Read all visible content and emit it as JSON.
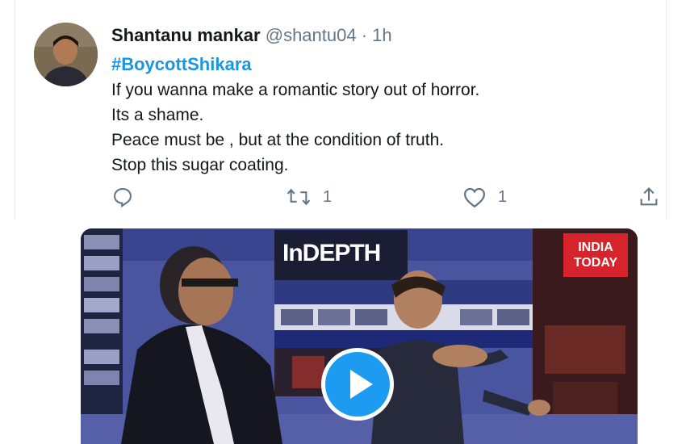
{
  "tweet": {
    "author_name": "Shantanu mankar",
    "handle": "@shantu04",
    "separator": "·",
    "time": "1h",
    "hashtag": "#BoycottShikara",
    "lines": [
      "If you wanna make a romantic story out of horror.",
      "Its a shame.",
      "Peace must be , but at the condition of truth.",
      "Stop this sugar coating."
    ]
  },
  "actions": {
    "retweet_count": "1",
    "like_count": "1",
    "icons": [
      "reply-icon",
      "retweet-icon",
      "like-icon",
      "share-icon"
    ]
  },
  "video": {
    "show_logo": "InDEPTH",
    "channel_line1": "INDIA",
    "channel_line2": "TODAY",
    "play_icon": "play-icon",
    "colors": {
      "studio": "#4a55a0",
      "badge": "#d7232b",
      "play": "#1d9bf0"
    }
  }
}
